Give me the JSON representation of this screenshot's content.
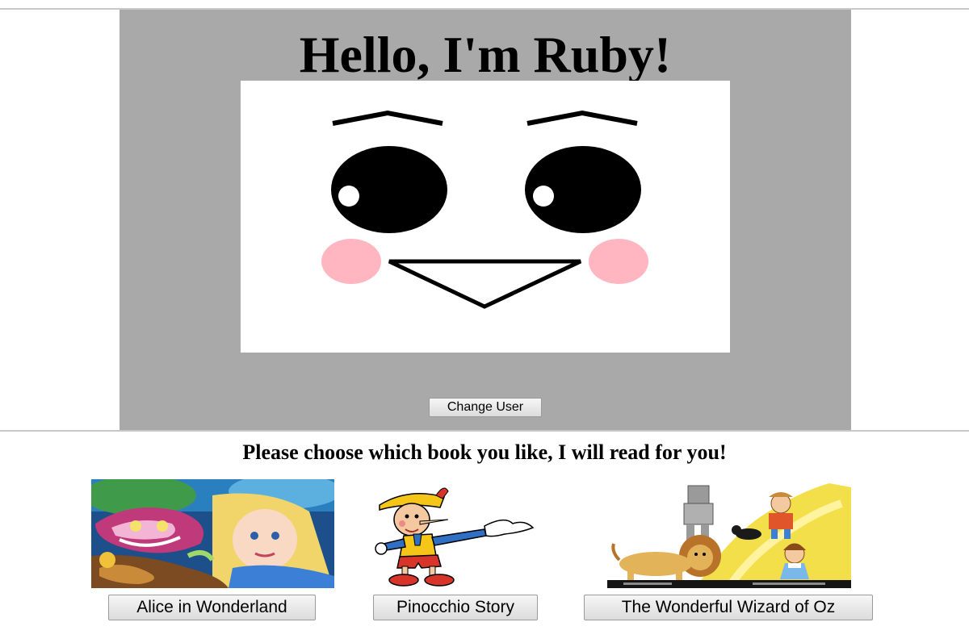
{
  "header": {
    "greeting": "Hello, I'm Ruby!"
  },
  "avatar": {
    "colors": {
      "stage_background": "#a9a9a9",
      "face_background": "#ffffff",
      "features": "#000000",
      "cheeks": "#ffb6c1"
    }
  },
  "controls": {
    "change_user_label": "Change User"
  },
  "books_section": {
    "prompt": "Please choose which book you like, I will read for you!",
    "books": [
      {
        "label": "Alice in Wonderland",
        "cover_icon": "alice-cover-illustration"
      },
      {
        "label": "Pinocchio Story",
        "cover_icon": "pinocchio-cover-illustration"
      },
      {
        "label": "The Wonderful Wizard of Oz",
        "cover_icon": "wizard-of-oz-cover-illustration"
      }
    ]
  }
}
